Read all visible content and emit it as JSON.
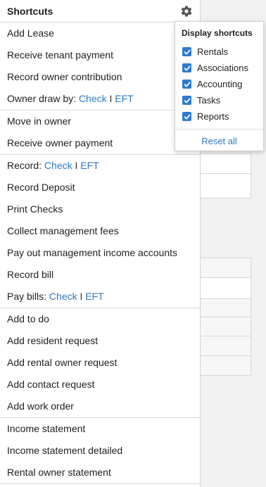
{
  "panel": {
    "title": "Shortcuts",
    "sections": [
      {
        "items": [
          {
            "label": "Add Lease"
          },
          {
            "label": "Receive tenant payment"
          },
          {
            "label": "Record owner contribution"
          },
          {
            "label": "Owner draw by:",
            "links": [
              "Check",
              "EFT"
            ]
          }
        ]
      },
      {
        "items": [
          {
            "label": "Move in owner"
          },
          {
            "label": "Receive owner payment"
          }
        ]
      },
      {
        "items": [
          {
            "label": "Record:",
            "links": [
              "Check",
              "EFT"
            ]
          },
          {
            "label": "Record Deposit"
          },
          {
            "label": "Print Checks"
          },
          {
            "label": "Collect management fees"
          },
          {
            "label": "Pay out management income accounts"
          },
          {
            "label": "Record bill"
          },
          {
            "label": "Pay bills:",
            "links": [
              "Check",
              "EFT"
            ]
          }
        ]
      },
      {
        "items": [
          {
            "label": "Add to do"
          },
          {
            "label": "Add resident request"
          },
          {
            "label": "Add rental owner request"
          },
          {
            "label": "Add contact request"
          },
          {
            "label": "Add work order"
          }
        ]
      },
      {
        "items": [
          {
            "label": "Income statement"
          },
          {
            "label": "Income statement detailed"
          },
          {
            "label": "Rental owner statement"
          }
        ]
      }
    ],
    "separator": "I"
  },
  "menu": {
    "title": "Display shortcuts",
    "options": [
      {
        "label": "Rentals",
        "checked": true
      },
      {
        "label": "Associations",
        "checked": true
      },
      {
        "label": "Accounting",
        "checked": true
      },
      {
        "label": "Tasks",
        "checked": true
      },
      {
        "label": "Reports",
        "checked": true
      }
    ],
    "reset_label": "Reset all"
  },
  "icons": {
    "settings": "gear-icon",
    "checkbox": "check-icon"
  },
  "colors": {
    "link": "#2a7ac0",
    "checkbox": "#2b7bd4"
  }
}
